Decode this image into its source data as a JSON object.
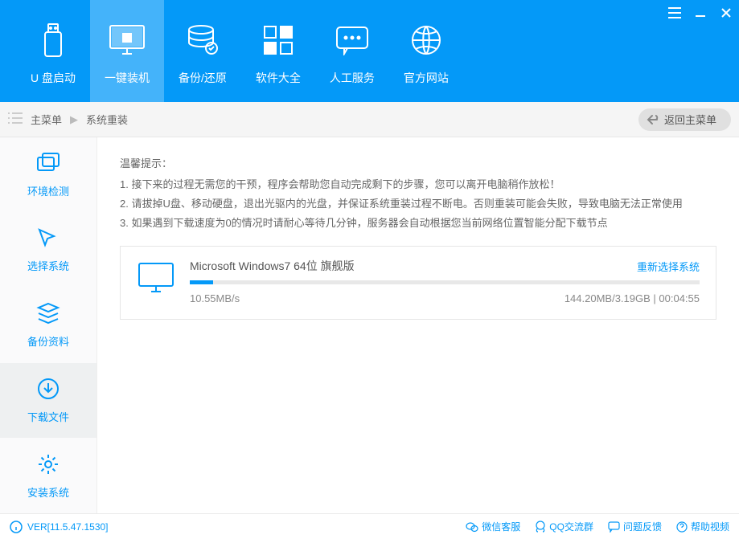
{
  "titlebar": {
    "menu": "≡",
    "min": "—",
    "close": "✕"
  },
  "topnav": [
    {
      "label": "U 盘启动"
    },
    {
      "label": "一键装机"
    },
    {
      "label": "备份/还原"
    },
    {
      "label": "软件大全"
    },
    {
      "label": "人工服务"
    },
    {
      "label": "官方网站"
    }
  ],
  "breadcrumb": {
    "root": "主菜单",
    "current": "系统重装",
    "back": "返回主菜单"
  },
  "sidebar": [
    {
      "label": "环境检测"
    },
    {
      "label": "选择系统"
    },
    {
      "label": "备份资料"
    },
    {
      "label": "下载文件"
    },
    {
      "label": "安装系统"
    }
  ],
  "tips": {
    "title": "温馨提示：",
    "items": [
      "1. 接下来的过程无需您的干预，程序会帮助您自动完成剩下的步骤，您可以离开电脑稍作放松！",
      "2. 请拔掉U盘、移动硬盘，退出光驱内的光盘，并保证系统重装过程不断电。否则重装可能会失败，导致电脑无法正常使用",
      "3. 如果遇到下载速度为0的情况时请耐心等待几分钟，服务器会自动根据您当前网络位置智能分配下载节点"
    ]
  },
  "download": {
    "title": "Microsoft Windows7 64位 旗舰版",
    "relink": "重新选择系统",
    "speed": "10.55MB/s",
    "progress": "144.20MB/3.19GB | 00:04:55"
  },
  "footer": {
    "ver": "VER[11.5.47.1530]",
    "links": [
      "微信客服",
      "QQ交流群",
      "问题反馈",
      "帮助视频"
    ]
  }
}
